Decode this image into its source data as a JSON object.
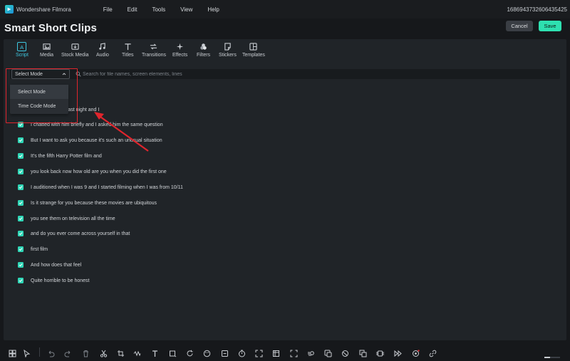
{
  "app": {
    "name": "Wondershare Filmora",
    "menus": [
      "File",
      "Edit",
      "Tools",
      "View",
      "Help"
    ],
    "session_id": "1686943732606435425"
  },
  "header": {
    "title": "Smart Short Clips",
    "cancel_label": "Cancel",
    "save_label": "Save"
  },
  "toolbar": {
    "tabs": [
      {
        "label": "Script",
        "icon": "script-icon"
      },
      {
        "label": "Media",
        "icon": "media-icon"
      },
      {
        "label": "Stock Media",
        "icon": "stock-media-icon"
      },
      {
        "label": "Audio",
        "icon": "audio-icon"
      },
      {
        "label": "Titles",
        "icon": "titles-icon"
      },
      {
        "label": "Transitions",
        "icon": "transitions-icon"
      },
      {
        "label": "Effects",
        "icon": "effects-icon"
      },
      {
        "label": "Filters",
        "icon": "filters-icon"
      },
      {
        "label": "Stickers",
        "icon": "stickers-icon"
      },
      {
        "label": "Templates",
        "icon": "templates-icon"
      }
    ],
    "active": "Script"
  },
  "search": {
    "mode_selected": "Select Mode",
    "placeholder": "Search for file names, screen elements, lines",
    "mode_options": [
      "Select Mode",
      "Time Code Mode"
    ]
  },
  "script_lines": [
    "lcliffe last night and I",
    "I chatted with him briefly and I asked him the same question",
    "But I want to ask you because it's such an unusual situation",
    "It's the fifth Harry Potter film and",
    "you look back now how old are you when you did the first one",
    "I auditioned when I was 9 and I started filming when I was from 10/11",
    "Is it strange for you because these movies are ubiquitous",
    "you see them on television all the time",
    "and do you ever come across yourself in that",
    "first film",
    "And how does that feel",
    "Quite horrible to be honest"
  ],
  "colors": {
    "accent": "#2fd6b6",
    "active_tab": "#3ec7e0",
    "save": "#2ee0b0",
    "annotation": "#e0252d"
  }
}
